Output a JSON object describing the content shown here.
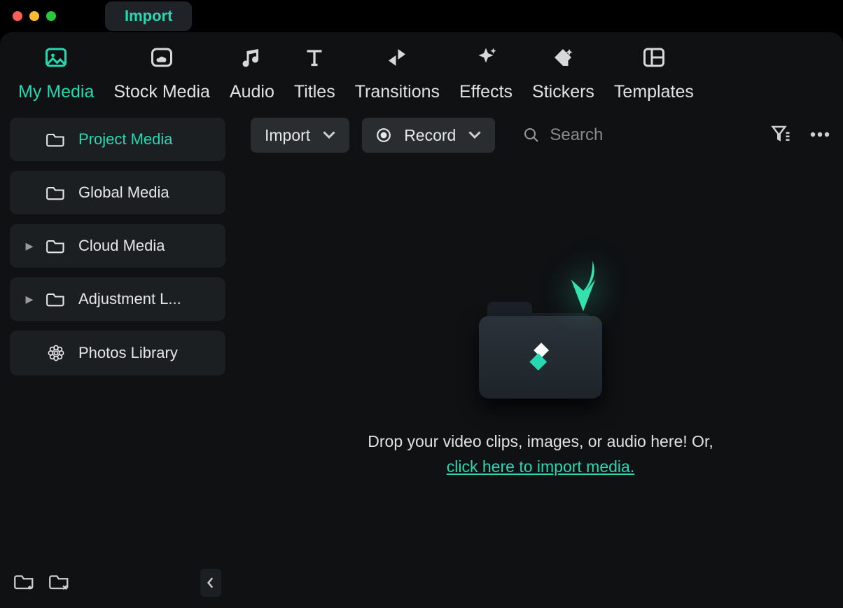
{
  "titlebar": {
    "tab_label": "Import"
  },
  "top_tabs": [
    {
      "label": "My Media",
      "active": true,
      "icon": "image"
    },
    {
      "label": "Stock Media",
      "active": false,
      "icon": "cloud"
    },
    {
      "label": "Audio",
      "active": false,
      "icon": "music"
    },
    {
      "label": "Titles",
      "active": false,
      "icon": "text"
    },
    {
      "label": "Transitions",
      "active": false,
      "icon": "transition"
    },
    {
      "label": "Effects",
      "active": false,
      "icon": "sparkle"
    },
    {
      "label": "Stickers",
      "active": false,
      "icon": "sticker"
    },
    {
      "label": "Templates",
      "active": false,
      "icon": "layout"
    }
  ],
  "sidebar": {
    "items": [
      {
        "label": "Project Media",
        "icon": "folder",
        "has_children": false,
        "active": true
      },
      {
        "label": "Global Media",
        "icon": "folder",
        "has_children": false,
        "active": false
      },
      {
        "label": "Cloud Media",
        "icon": "folder",
        "has_children": true,
        "active": false
      },
      {
        "label": "Adjustment L...",
        "icon": "folder",
        "has_children": true,
        "active": false
      },
      {
        "label": "Photos Library",
        "icon": "photos",
        "has_children": false,
        "active": false
      }
    ]
  },
  "toolbar": {
    "import_label": "Import",
    "record_label": "Record",
    "search_placeholder": "Search"
  },
  "dropzone": {
    "line1": "Drop your video clips, images, or audio here! Or,",
    "link_text": "click here to import media."
  },
  "colors": {
    "accent": "#27d8b3"
  }
}
